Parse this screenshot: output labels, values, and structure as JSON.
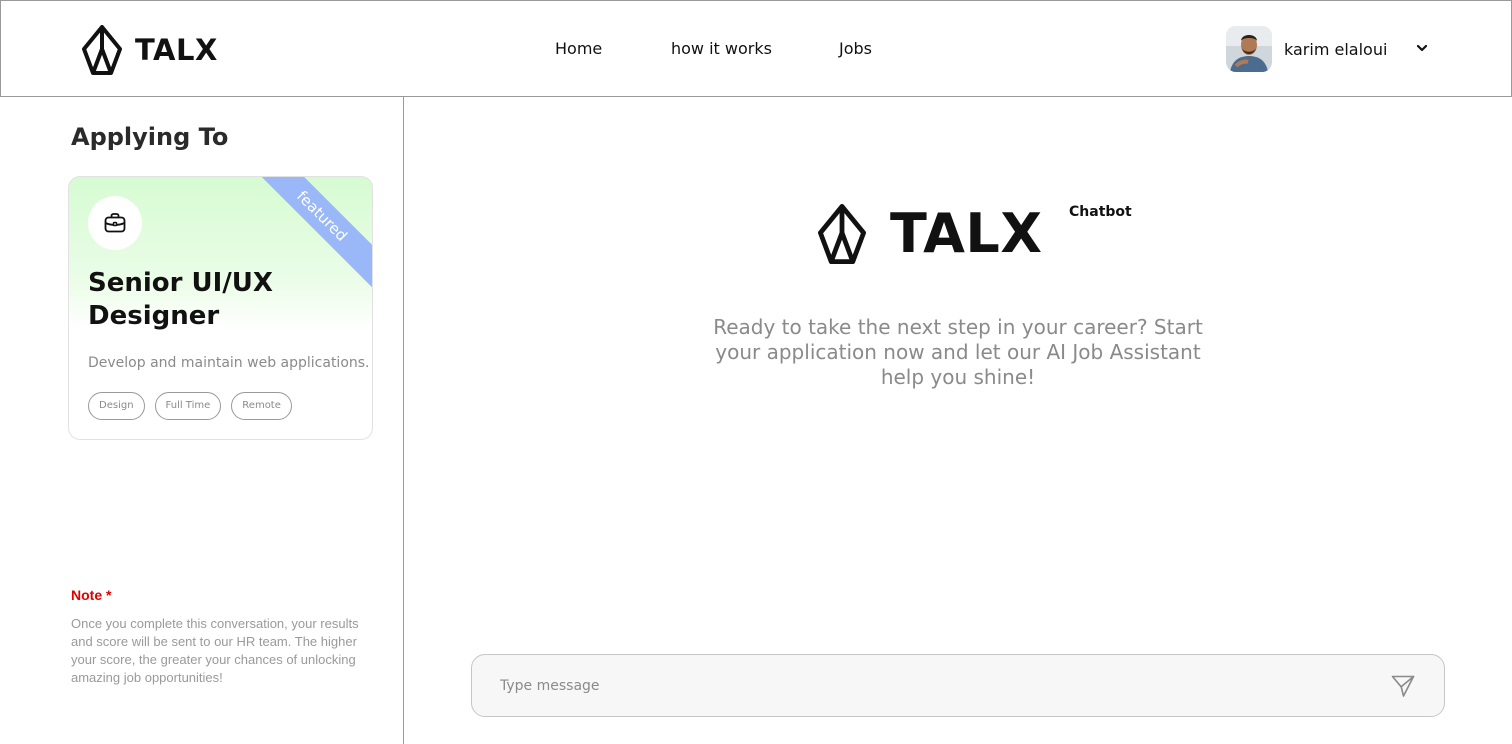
{
  "header": {
    "logo_text": "TALX",
    "nav": [
      {
        "label": "Home"
      },
      {
        "label": "how it works"
      },
      {
        "label": "Jobs"
      }
    ],
    "user": {
      "name": "karim elaloui"
    }
  },
  "sidebar": {
    "title": "Applying To",
    "job_card": {
      "ribbon": "featured",
      "title": "Senior UI/UX Designer",
      "description": "Develop and maintain web applications.",
      "tags": [
        "Design",
        "Full Time",
        "Remote"
      ]
    },
    "note": {
      "label": "Note *",
      "text": "Once you complete this conversation, your results and score will be sent to our HR team. The higher your score, the greater your chances of unlocking amazing job opportunities!"
    }
  },
  "main": {
    "brand_text": "TALX",
    "brand_subtitle": "Chatbot",
    "welcome": "Ready to take the next step in your career? Start your application now and let our AI Job Assistant help you shine!",
    "message_input": {
      "placeholder": "Type message",
      "value": ""
    }
  },
  "colors": {
    "accent_ribbon": "#9ab8f7",
    "card_gradient_top": "#d6fbd2",
    "note_red": "#e00000",
    "border": "#9a9a9a"
  },
  "icons": {
    "logo": "talx-logo-icon",
    "briefcase": "briefcase-icon",
    "chevron": "chevron-down-icon",
    "send": "send-icon"
  }
}
